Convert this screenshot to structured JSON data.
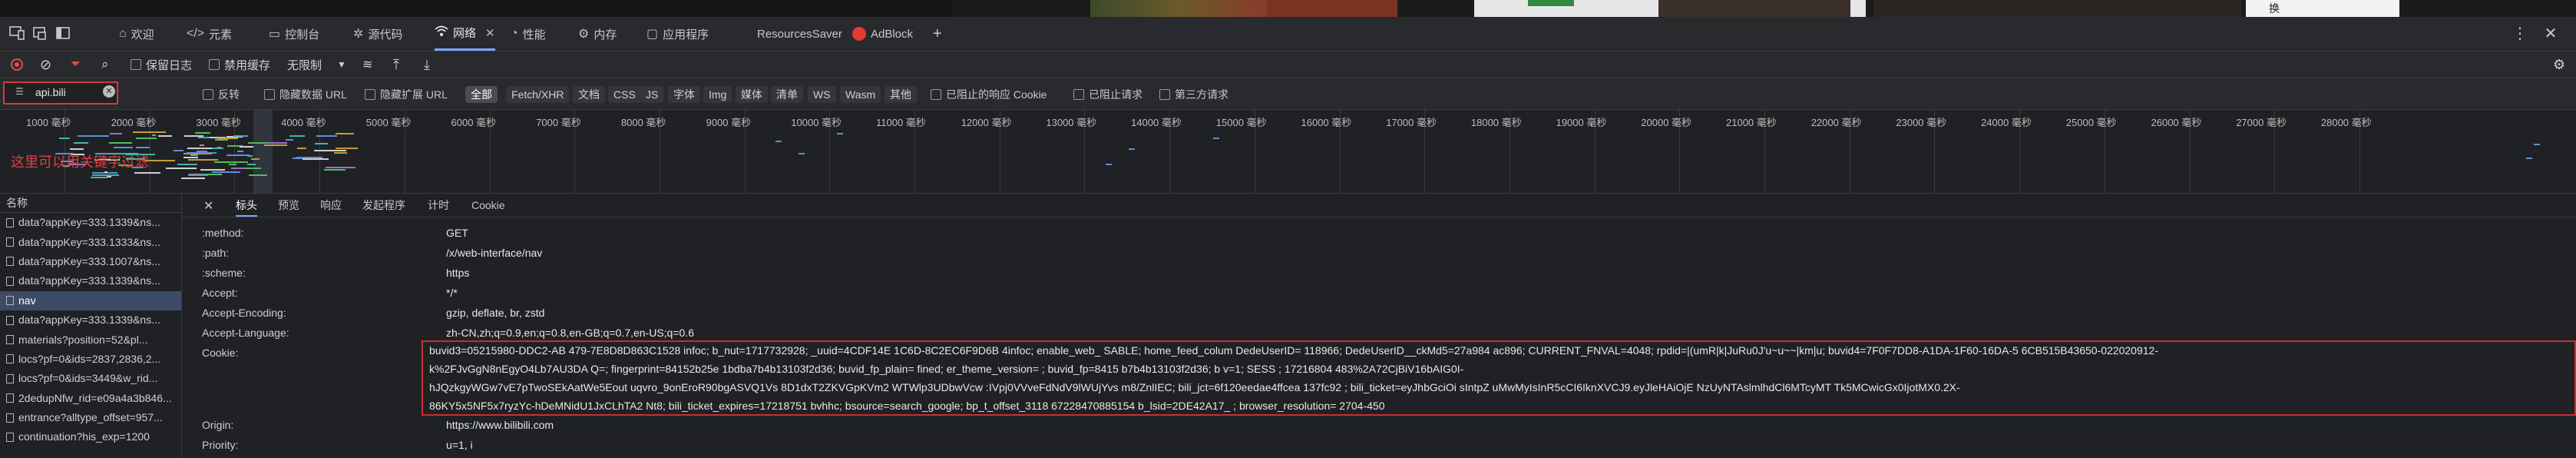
{
  "page_strip": {
    "right_text": "换"
  },
  "tabbar": {
    "tabs": [
      {
        "label": "欢迎",
        "icon": "home-icon"
      },
      {
        "label": "元素",
        "icon": "code-icon"
      },
      {
        "label": "控制台",
        "icon": "console-icon"
      },
      {
        "label": "源代码",
        "icon": "bug-icon"
      },
      {
        "label": "网络",
        "icon": "wifi-icon",
        "active": true
      },
      {
        "label": "性能",
        "icon": "gauge-icon"
      },
      {
        "label": "内存",
        "icon": "memory-icon"
      },
      {
        "label": "应用程序",
        "icon": "app-icon"
      },
      {
        "label": "ResourcesSaver",
        "icon": ""
      },
      {
        "label": "AdBlock",
        "icon": "adblock-icon"
      }
    ],
    "add_tab": "+"
  },
  "toolbar1": {
    "preserve_log": "保留日志",
    "disable_cache": "禁用缓存",
    "throttle": "无限制"
  },
  "filter": {
    "value": "api.bili",
    "invert": "反转",
    "hide_data_urls": "隐藏数据 URL",
    "hide_ext_urls": "隐藏扩展 URL",
    "types": [
      "全部",
      "Fetch/XHR",
      "文档",
      "CSS",
      "JS",
      "字体",
      "Img",
      "媒体",
      "清单",
      "WS",
      "Wasm",
      "其他"
    ],
    "blocked_response_cookies": "已阻止的响应 Cookie",
    "blocked_requests": "已阻止请求",
    "third_party": "第三方请求"
  },
  "timeline": {
    "ticks": [
      "1000 毫秒",
      "2000 毫秒",
      "3000 毫秒",
      "4000 毫秒",
      "5000 毫秒",
      "6000 毫秒",
      "7000 毫秒",
      "8000 毫秒",
      "9000 毫秒",
      "10000 毫秒",
      "11000 毫秒",
      "12000 毫秒",
      "13000 毫秒",
      "14000 毫秒",
      "15000 毫秒",
      "16000 毫秒",
      "17000 毫秒",
      "18000 毫秒",
      "19000 毫秒",
      "20000 毫秒",
      "21000 毫秒",
      "22000 毫秒",
      "23000 毫秒",
      "24000 毫秒",
      "25000 毫秒",
      "26000 毫秒",
      "27000 毫秒",
      "28000 毫秒"
    ],
    "annotation": "这里可以用关键字过滤"
  },
  "requests": {
    "header": "名称",
    "rows": [
      "data?appKey=333.1339&ns...",
      "data?appKey=333.1333&ns...",
      "data?appKey=333.1007&ns...",
      "data?appKey=333.1339&ns...",
      "nav",
      "data?appKey=333.1339&ns...",
      "materials?position=52&pl...",
      "locs?pf=0&ids=2837,2836,2...",
      "locs?pf=0&ids=3449&w_rid...",
      "2dedupNfw_rid=e09a4a3b846...",
      "entrance?alltype_offset=957...",
      "continuation?his_exp=1200"
    ],
    "selected_index": 4
  },
  "details": {
    "tabs": [
      "标头",
      "预览",
      "响应",
      "发起程序",
      "计时",
      "Cookie"
    ],
    "active_tab": 0,
    "headers": [
      {
        "key": ":method:",
        "value": "GET"
      },
      {
        "key": ":path:",
        "value": "/x/web-interface/nav"
      },
      {
        "key": ":scheme:",
        "value": "https"
      },
      {
        "key": "Accept:",
        "value": "*/*"
      },
      {
        "key": "Accept-Encoding:",
        "value": "gzip, deflate, br, zstd"
      },
      {
        "key": "Accept-Language:",
        "value": "zh-CN,zh;q=0.9,en;q=0.8,en-GB;q=0.7,en-US;q=0.6"
      },
      {
        "key": "Cookie:",
        "value": ""
      },
      {
        "key": "Origin:",
        "value": "https://www.bilibili.com"
      },
      {
        "key": "Priority:",
        "value": "u=1, i"
      }
    ],
    "cookie_lines": [
      "buvid3=05215980-DDC2-AB         479-7E8D8D863C1528        infoc; b_nut=1717732928; _uuid=4CDF14E         1C6D-8C2EC6F9D6B         4infoc; enable_web_          SABLE; home_feed_colum        DedeUserID=       118966; DedeUserID__ckMd5=27a984         ac896; CURRENT_FNVAL=4048; rpdid=|(umR|k|JuRu0J'u~u~~|km|u; buvid4=7F0F7DD8-A1DA-1F60-16DA-5        6CB515B43650-022020912-",
      "k%2FJvGgN8nEgyO4Lb7AU3DA        Q=; fingerprint=84152b25e       1bdba7b4b13103f2d36; buvid_fp_plain=      fined;       er_theme_version=      ; buvid_fp=8415        b7b4b13103f2d36; b         v=1; SESS        ; 17216804       483%2A72CjBiV16bAIG0I-",
      "hJQzkgyWGw7vE7pTwoSEkAatWe5Eout        uqvro_9onEroR90bgASVQ1Vs       8D1dxT2ZKVGpKVm2     WTWlp3UDbwVcw       :IVpj0VVveFdNdV9lWUjYvs       m8/ZnlIEC; bili_jct=6f120eedae4ffcea        137fc92        ; bili_ticket=eyJhbGciOi       sIntpZ        uMwMyIsInR5cCI6IknXVCJ9.eyJleHAiOjE        NzUyNTAslmlhdCl6MTcyMT       Tk5MCwicGx0IjotMX0.2X-",
      "86KY5x5NF5x7ryzYc-hDeMNidU1JxCLhTA2       Nt8; bili_ticket_expires=17218751         bvhhc; bsource=search_google; bp_t_offset_3118        67228470885154       b_lsid=2DE42A17_        ; browser_resolution=       2704-450"
    ]
  }
}
